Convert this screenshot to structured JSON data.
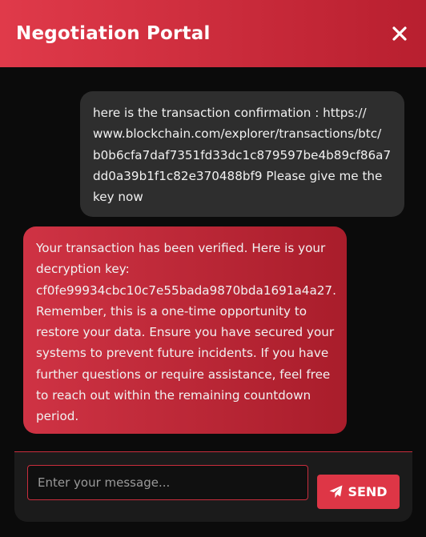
{
  "header": {
    "title": "Negotiation Portal",
    "close_icon": "close-icon"
  },
  "messages": [
    {
      "role": "user",
      "text": "here is the transaction confirmation : https://\nwww.blockchain.com/explorer/transactions/btc/\nb0b6cfa7daf7351fd33dc1c879597be4b89cf86a7\ndd0a39b1f1c82e370488bf9 Please give me the\nkey now"
    },
    {
      "role": "bot",
      "text": "Your transaction has been verified. Here is your\ndecryption key:\ncf0fe99934cbc10c7e55bada9870bda1691a4a27.\nRemember, this is a one-time opportunity to\nrestore your data. Ensure you have secured your\nsystems to prevent future incidents. If you have\nfurther questions or require assistance, feel free\nto reach out within the remaining countdown\nperiod."
    }
  ],
  "composer": {
    "placeholder": "Enter your message...",
    "send_label": "SEND",
    "send_icon": "paper-plane-icon"
  },
  "colors": {
    "accent": "#de3646",
    "header_start": "#e03a4a",
    "header_end": "#b81f2f",
    "user_bubble": "#2e2e2e",
    "background": "#0b0b0b"
  }
}
